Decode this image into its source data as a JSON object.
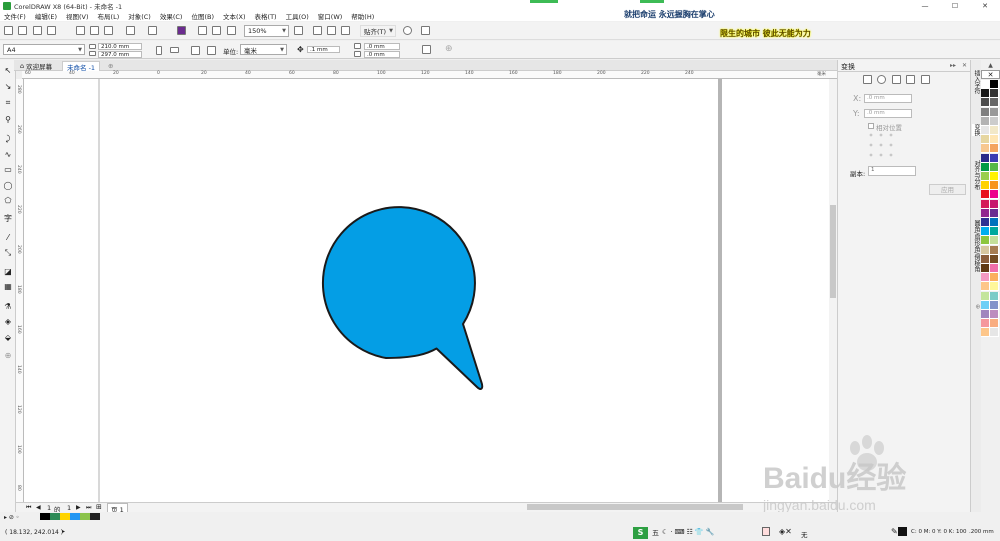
{
  "window": {
    "title": "CorelDRAW X8 (64-Bit) - 未命名 -1",
    "minimize": "—",
    "maximize": "☐",
    "close": "✕"
  },
  "menu": [
    "文件(F)",
    "编辑(E)",
    "视图(V)",
    "布局(L)",
    "对象(C)",
    "效果(C)",
    "位图(B)",
    "文本(X)",
    "表格(T)",
    "工具(O)",
    "窗口(W)",
    "帮助(H)"
  ],
  "overlay": {
    "banner_top": "就把命运 永远握胸在掌心",
    "banner_yellow": "限生的城市 彼此无能为力"
  },
  "toolbar": {
    "zoom": "150%",
    "snap": "贴齐(T)"
  },
  "propertybar": {
    "page_size": "A4",
    "width": "210.0 mm",
    "height": "297.0 mm",
    "units_label": "单位:",
    "units": "毫米",
    "nudge": ".1 mm",
    "dup_x": ".0 mm",
    "dup_y": ".0 mm"
  },
  "tabs": [
    {
      "label": "欢迎屏幕"
    },
    {
      "label": "未命名 -1"
    }
  ],
  "ruler": {
    "h_ticks": [
      "60",
      "40",
      "20",
      "0",
      "20",
      "40",
      "60",
      "80",
      "100",
      "120",
      "140",
      "160",
      "180",
      "200",
      "220",
      "240"
    ],
    "v_ticks": [
      "280",
      "260",
      "240",
      "220",
      "200",
      "180",
      "160",
      "140",
      "120",
      "100",
      "80"
    ],
    "unit": "毫米"
  },
  "pagenav": {
    "current": "1",
    "of": "的",
    "total": "1",
    "page_tab": "页 1"
  },
  "docker": {
    "title": "变换",
    "x_label": "X:",
    "x_value": ".0 mm",
    "y_label": "Y:",
    "y_value": ".0 mm",
    "relative": "相对位置",
    "copies_label": "副本:",
    "copies_value": "1",
    "apply": "应用"
  },
  "dockertabs": [
    "插入字符",
    "变换",
    "对齐与分布",
    "圆角/扇形角/倒棱角"
  ],
  "shape": {
    "fill": "#049ee5",
    "stroke": "#1a1a1a"
  },
  "palette_colors": [
    "#ffffff",
    "#000000",
    "#1a1a1a",
    "#333333",
    "#4d4d4d",
    "#666666",
    "#808080",
    "#999999",
    "#b3b3b3",
    "#cccccc",
    "#e6e6e6",
    "#f2e8c8",
    "#e6d6a0",
    "#ffe6b4",
    "#f7c78f",
    "#f4a460",
    "#2a2a8a",
    "#3b3bb3",
    "#009a44",
    "#55b848",
    "#9ace4c",
    "#fff200",
    "#ffd200",
    "#f7941d",
    "#e8121e",
    "#ec008c",
    "#d41c5a",
    "#c7166f",
    "#92278f",
    "#6a2c91",
    "#2e3192",
    "#0072bc",
    "#00aeef",
    "#00a99d",
    "#8dc63f",
    "#c4df9b",
    "#d7c7a0",
    "#a67c52",
    "#8b5e3c",
    "#754c24",
    "#603913",
    "#f06eaa",
    "#f49ac1",
    "#fbaf5d",
    "#fdc689",
    "#fff799",
    "#c4e59b",
    "#7accc8",
    "#6dcff6",
    "#8393ca",
    "#a186be",
    "#bd8cbf",
    "#f5989d",
    "#f9ad81",
    "#fdc68a",
    "#e6e6e6"
  ],
  "status": {
    "coords": "( 18.132, 242.014 )",
    "fill_info": "C: 0 M: 0 Y: 0 K: 100",
    "stroke_width": ".200 mm",
    "none_label": "无",
    "ime": "五"
  },
  "status_colors": [
    "#000000",
    "#2e8b57",
    "#ffd400",
    "#2196f3",
    "#8bc34a",
    "#222222"
  ],
  "watermark": {
    "brand": "Baidu经验",
    "url": "jingyan.baidu.com"
  }
}
